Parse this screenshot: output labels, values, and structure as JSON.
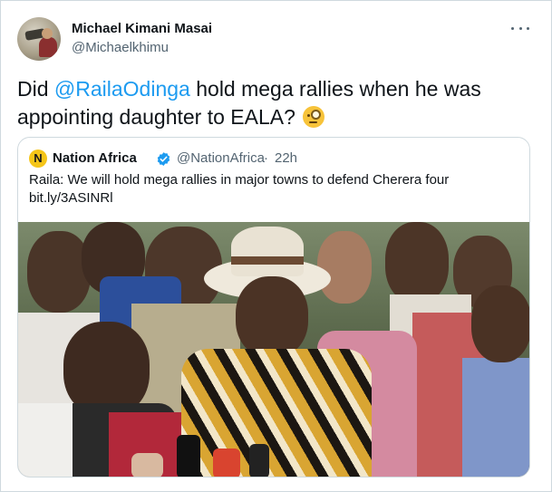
{
  "author": {
    "name": "Michael Kimani Masai",
    "handle": "@Michaelkhimu"
  },
  "tweet": {
    "text_before": "Did ",
    "mention": "@RailaOdinga",
    "text_after": " hold mega rallies when he was appointing daughter to EALA? "
  },
  "quote": {
    "avatar_letter": "N",
    "name": "Nation Africa",
    "handle": "@NationAfrica",
    "separator": "·",
    "time": "22h",
    "text": "Raila: We will hold mega rallies in major towns to defend Cherera four",
    "link": "bit.ly/3ASINRl"
  },
  "icons": {
    "more": "more-horizontal-icon",
    "verified": "verified-badge-icon",
    "emoji": "face-with-monocle-emoji"
  },
  "colors": {
    "accent": "#1d9bf0",
    "secondary_text": "#536471",
    "border": "#cfd9de",
    "brand_yellow": "#f5c518"
  }
}
